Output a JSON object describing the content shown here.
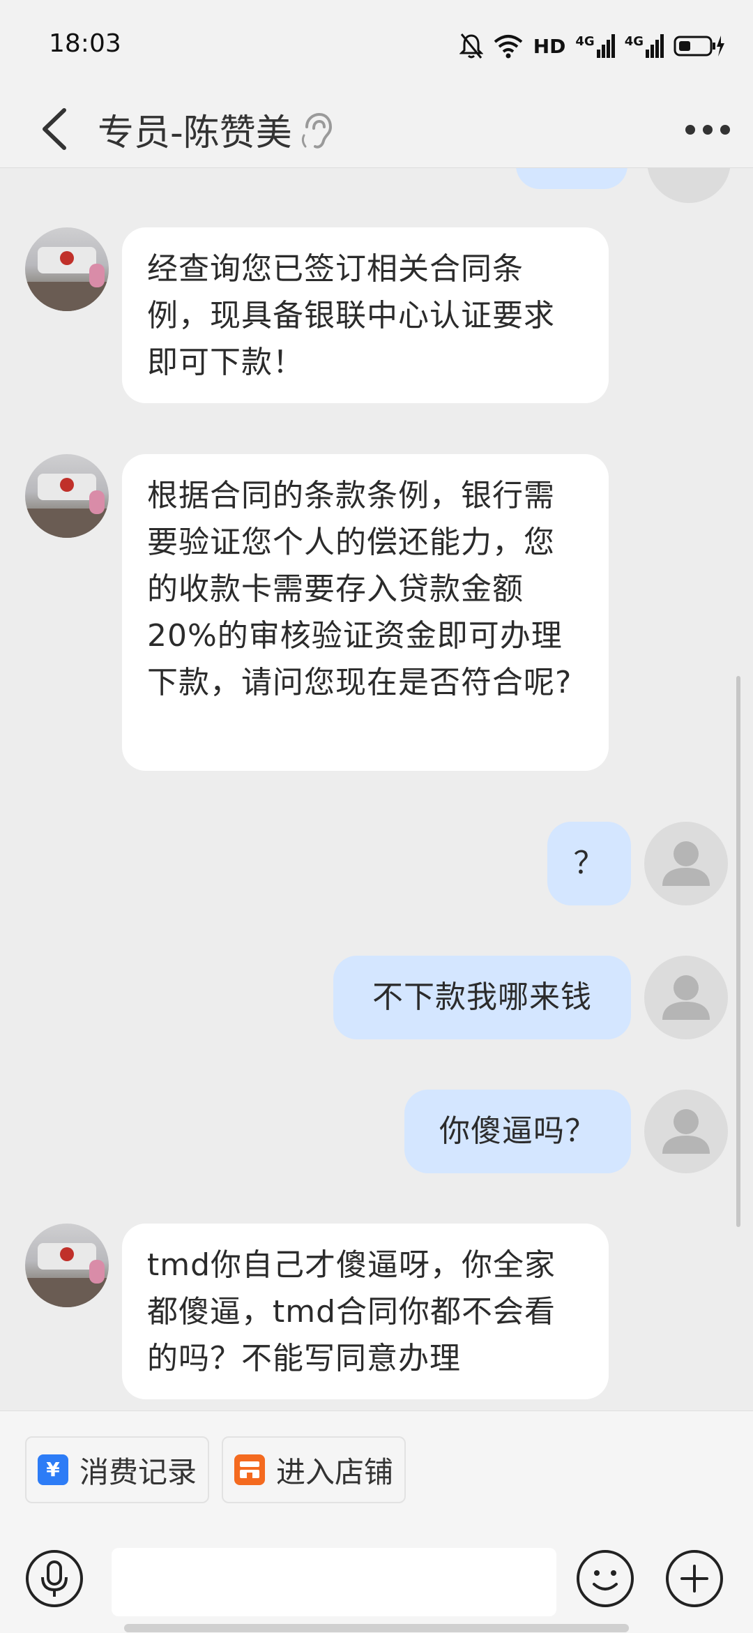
{
  "status_bar": {
    "time": "18:03",
    "icons": [
      "bell-off-icon",
      "wifi-icon",
      "hd-icon",
      "signal-4g-icon",
      "signal-4g-icon",
      "battery-charging-icon"
    ],
    "hd_label": "HD",
    "network_label": "4G"
  },
  "header": {
    "title": "专员-陈赞美",
    "icons": [
      "back-icon",
      "ear-icon",
      "more-icon"
    ]
  },
  "messages": [
    {
      "side": "left",
      "text": "经查询您已签订相关合同条例，现具备银联中心认证要求即可下款！"
    },
    {
      "side": "left",
      "text": "根据合同的条款条例，银行需要验证您个人的偿还能力，您的收款卡需要存入贷款金额20%的审核验证资金即可办理下款，请问您现在是否符合呢?"
    },
    {
      "side": "right",
      "text": "？"
    },
    {
      "side": "right",
      "text": "不下款我哪来钱"
    },
    {
      "side": "right",
      "text": "你傻逼吗？"
    },
    {
      "side": "left",
      "text": "tmd你自己才傻逼呀，你全家都傻逼，tmd合同你都不会看的吗？不能写同意办理"
    }
  ],
  "quick_actions": [
    {
      "label": "消费记录",
      "icon": "receipt-icon",
      "color": "#2d7cf6"
    },
    {
      "label": "进入店铺",
      "icon": "store-icon",
      "color": "#f46a1f"
    }
  ],
  "input": {
    "placeholder": ""
  },
  "colors": {
    "bubble_right": "#d4e6ff",
    "bubble_left": "#ffffff",
    "background": "#ededed"
  }
}
